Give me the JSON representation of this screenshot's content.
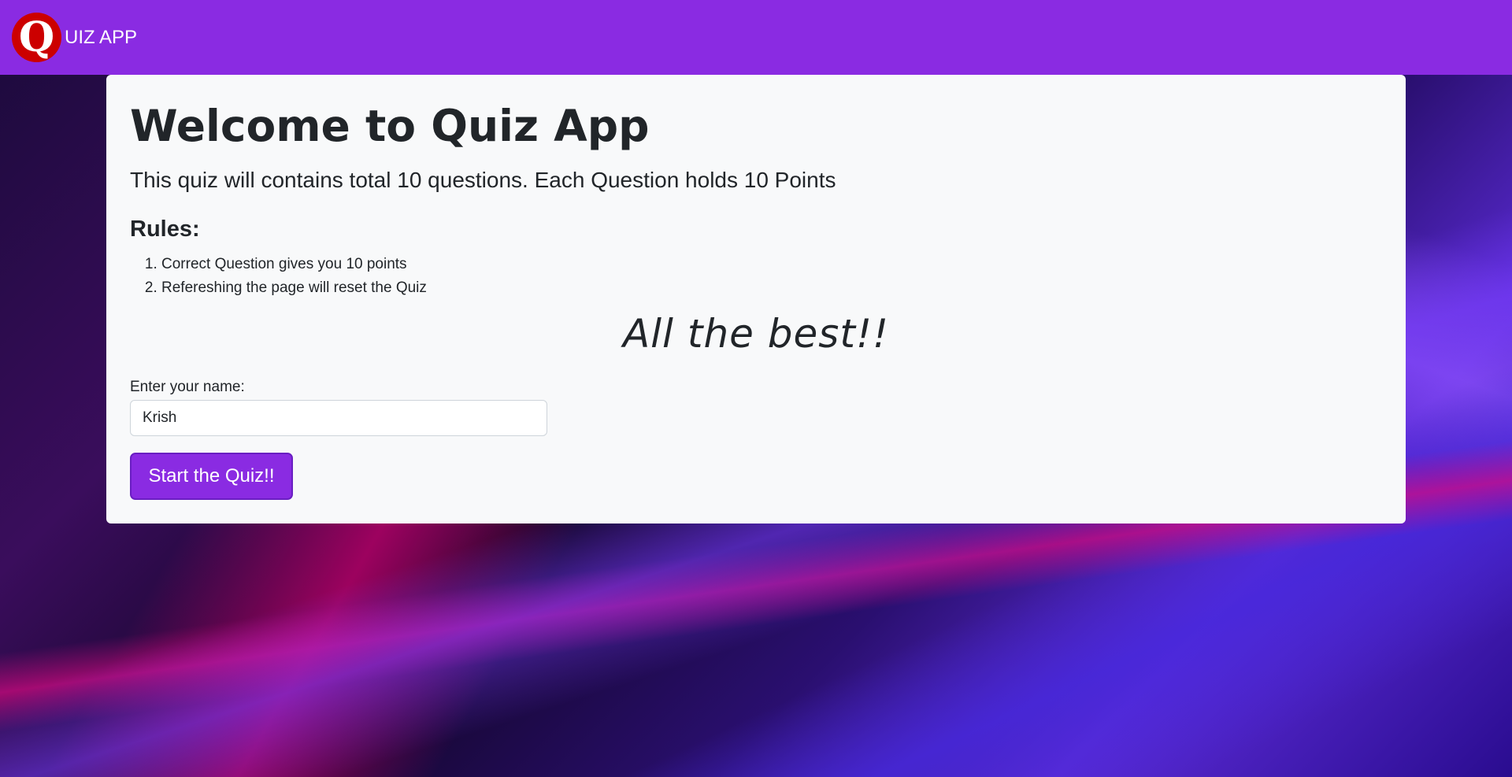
{
  "navbar": {
    "logo_letter": "Q",
    "brand_text": "UIZ APP",
    "background_color": "#8a2be2",
    "logo_color": "#cc0000"
  },
  "card": {
    "title": "Welcome to Quiz App",
    "subtitle": "This quiz will contains total 10 questions. Each Question holds 10 Points",
    "rules_heading": "Rules:",
    "rules": [
      "Correct Question gives you 10 points",
      "Refereshing the page will reset the Quiz"
    ],
    "best_wishes": "All the best!!",
    "name_label": "Enter your name:",
    "name_value": "Krish",
    "start_button_label": "Start the Quiz!!"
  }
}
